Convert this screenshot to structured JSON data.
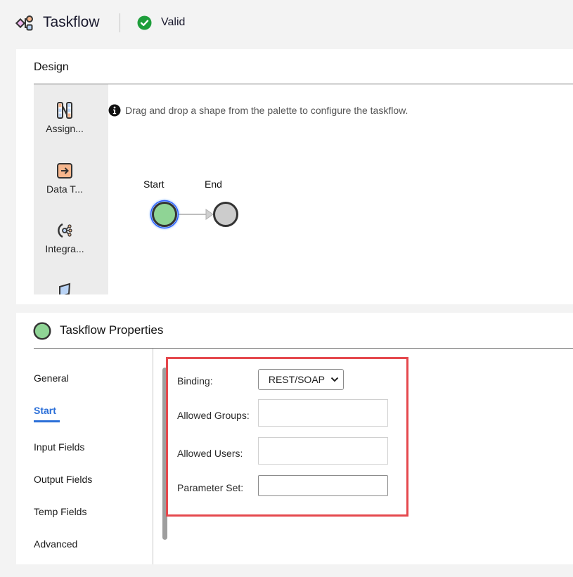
{
  "header": {
    "app_icon": "taskflow-icon",
    "title": "Taskflow",
    "status_icon": "check-circle-icon",
    "status_label": "Valid",
    "status_color": "#1e9e3b"
  },
  "design": {
    "title": "Design",
    "palette": [
      {
        "icon": "assignment-icon",
        "label": "Assign..."
      },
      {
        "icon": "data-task-icon",
        "label": "Data T..."
      },
      {
        "icon": "integration-icon",
        "label": "Integra..."
      },
      {
        "icon": "parallelogram-icon",
        "label": ""
      }
    ],
    "hint_icon": "info-icon",
    "hint": "Drag and drop a shape from the palette to configure the taskflow.",
    "nodes": [
      {
        "label": "Start",
        "type": "start",
        "fill": "#8fd495",
        "selected": true
      },
      {
        "label": "End",
        "type": "end",
        "fill": "#cccccc",
        "selected": false
      }
    ]
  },
  "properties": {
    "title": "Taskflow Properties",
    "nav": [
      {
        "label": "General",
        "active": false
      },
      {
        "label": "Start",
        "active": true
      },
      {
        "label": "Input Fields",
        "active": false
      },
      {
        "label": "Output Fields",
        "active": false
      },
      {
        "label": "Temp Fields",
        "active": false
      },
      {
        "label": "Advanced",
        "active": false
      }
    ],
    "form": {
      "binding_label": "Binding:",
      "binding_value": "REST/SOAP",
      "allowed_groups_label": "Allowed Groups:",
      "allowed_groups_value": "",
      "allowed_users_label": "Allowed Users:",
      "allowed_users_value": "",
      "parameter_set_label": "Parameter Set:",
      "parameter_set_value": ""
    },
    "highlight_color": "#e5484d",
    "accent_color": "#2b6fd8"
  }
}
